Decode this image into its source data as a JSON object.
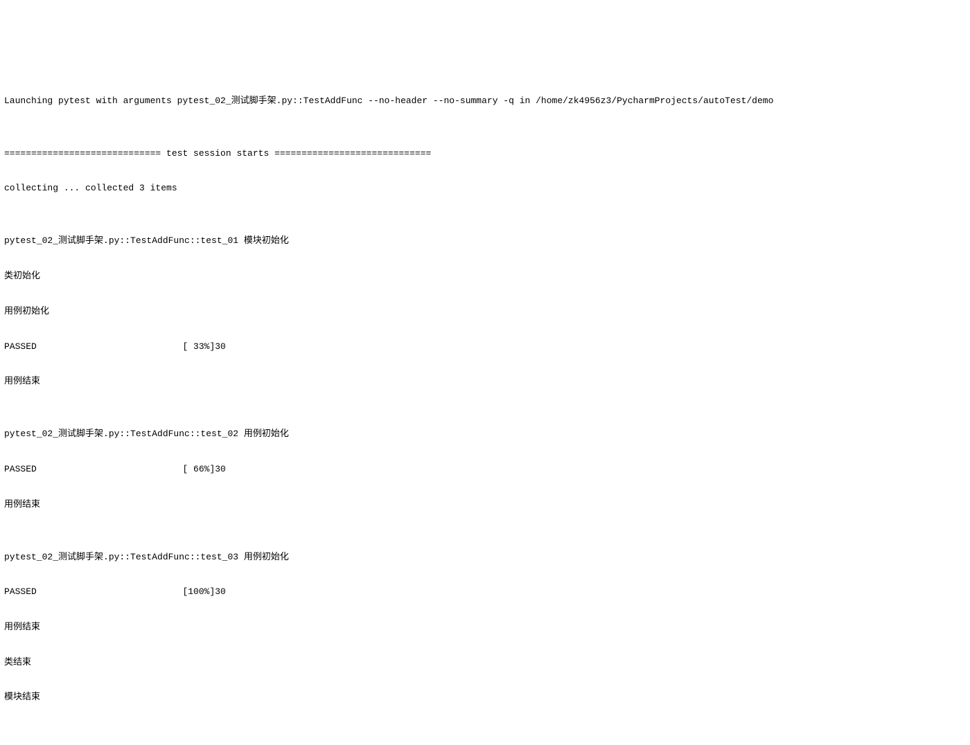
{
  "terminal": {
    "launch_line": "Launching pytest with arguments pytest_02_测试脚手架.py::TestAddFunc --no-header --no-summary -q in /home/zk4956z3/PycharmProjects/autoTest/demo",
    "blank1": "",
    "session_start": "============================= test session starts =============================",
    "collecting": "collecting ... collected 3 items",
    "blank2": "",
    "test1_header": "pytest_02_测试脚手架.py::TestAddFunc::test_01 模块初始化",
    "test1_class_init": "类初始化",
    "test1_case_init": "用例初始化",
    "test1_result": "PASSED                           [ 33%]30",
    "test1_case_end": "用例结束",
    "blank3": "",
    "test2_header": "pytest_02_测试脚手架.py::TestAddFunc::test_02 用例初始化",
    "test2_result": "PASSED                           [ 66%]30",
    "test2_case_end": "用例结束",
    "blank4": "",
    "test3_header": "pytest_02_测试脚手架.py::TestAddFunc::test_03 用例初始化",
    "test3_result": "PASSED                           [100%]30",
    "test3_case_end": "用例结束",
    "class_end": "类结束",
    "module_end": "模块结束"
  }
}
